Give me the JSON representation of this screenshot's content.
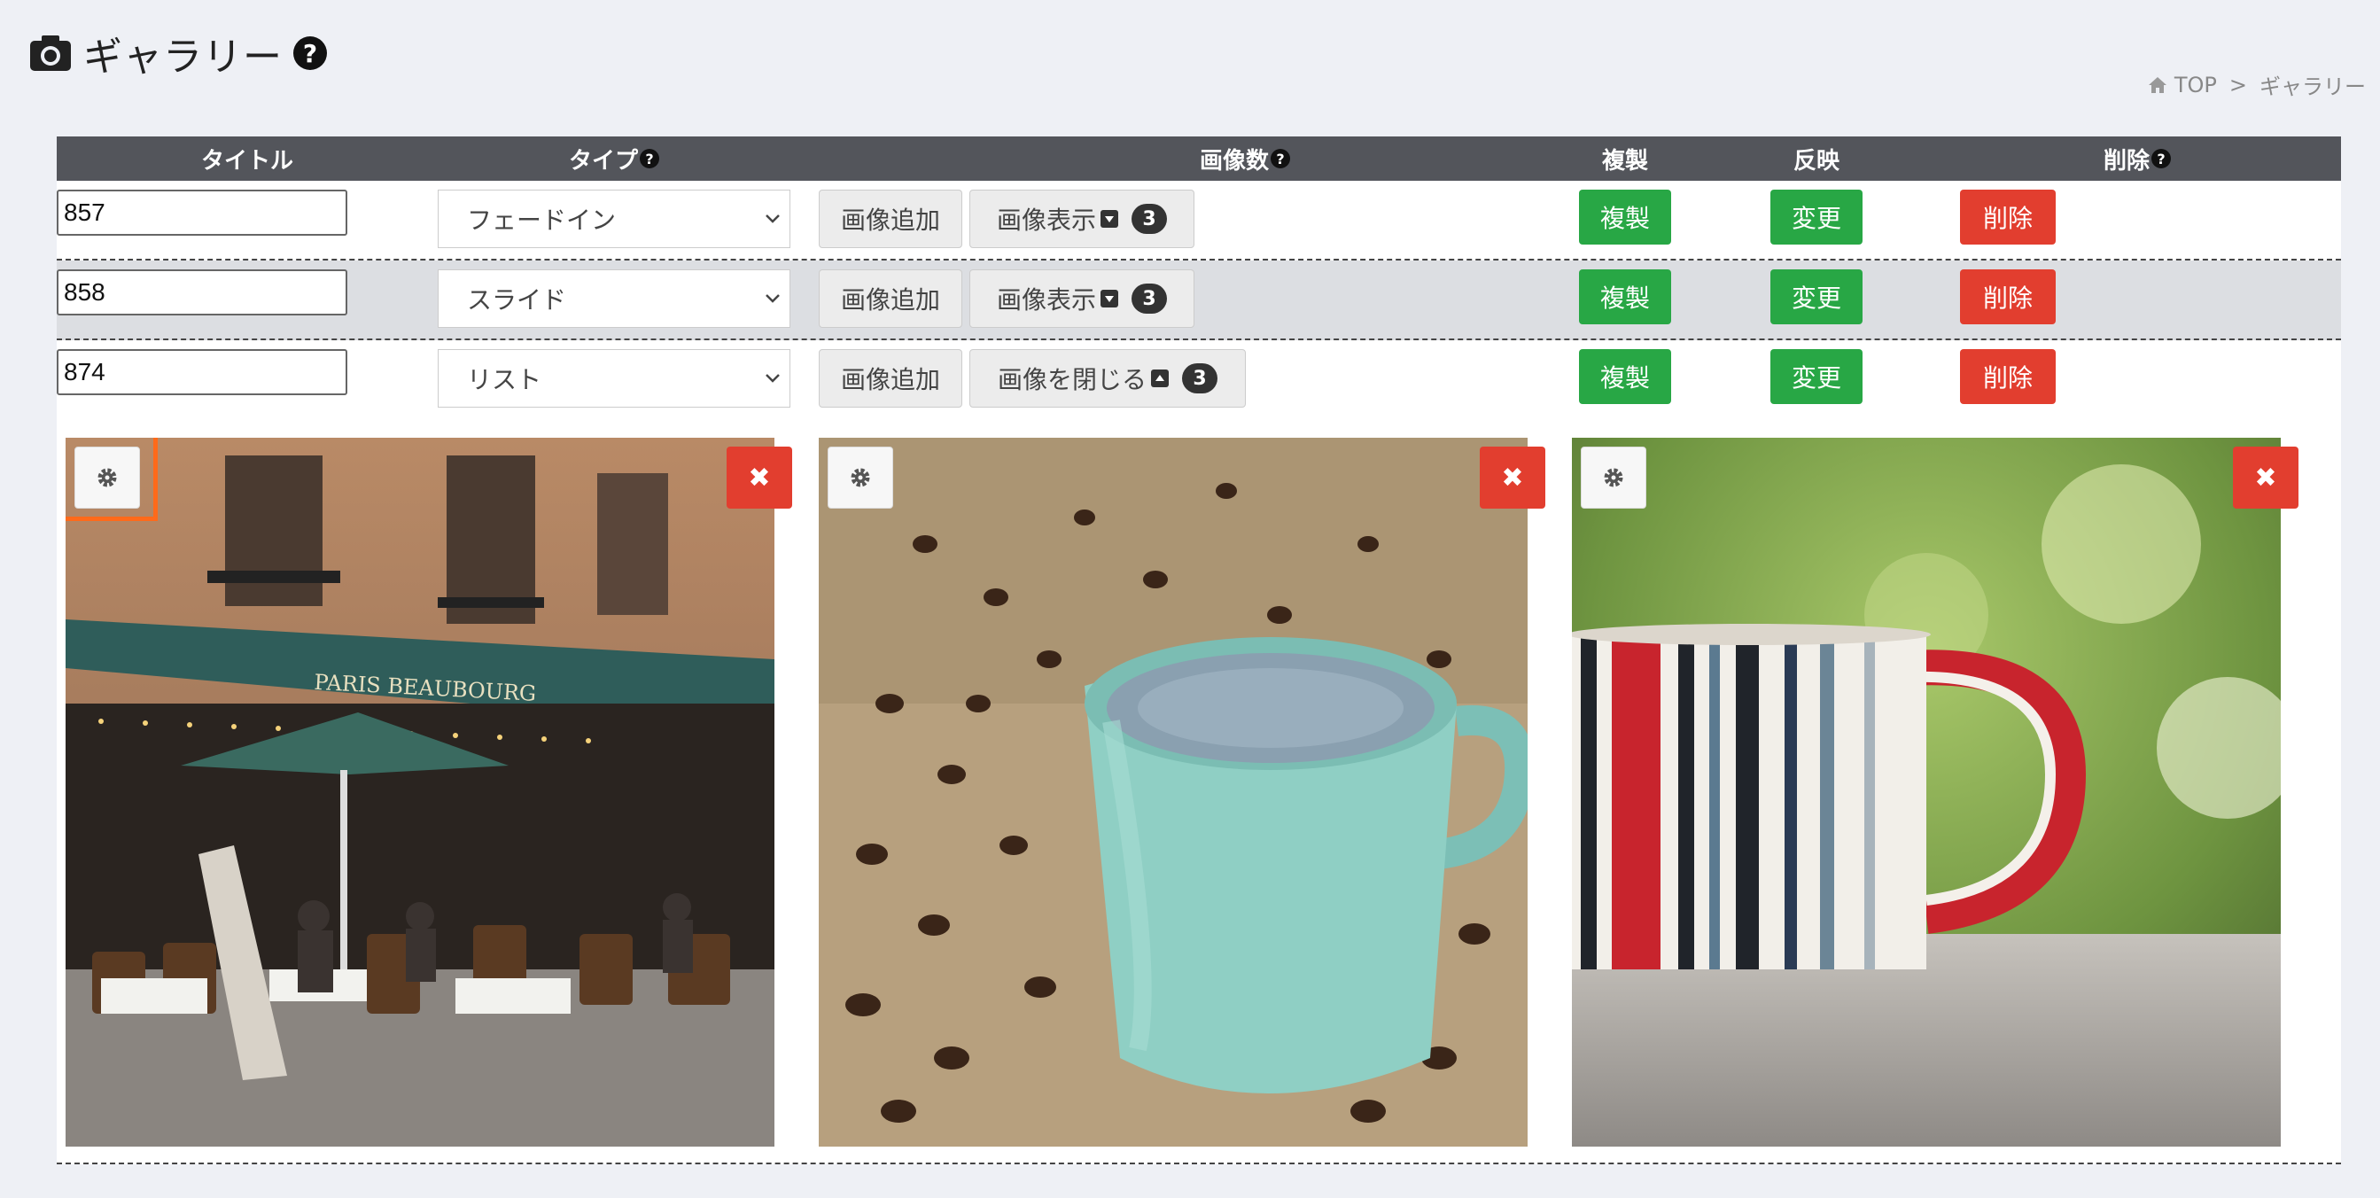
{
  "page": {
    "title": "ギャラリー",
    "help": "?",
    "breadcrumb": {
      "home": "TOP",
      "separator": ">",
      "current": "ギャラリー"
    }
  },
  "table": {
    "headers": {
      "title": "タイトル",
      "type": "タイプ",
      "image_count": "画像数",
      "copy": "複製",
      "apply": "反映",
      "delete": "削除"
    },
    "rows": [
      {
        "title_value": "857",
        "type": "フェードイン",
        "add_label": "画像追加",
        "view_label": "画像表示",
        "count": "3",
        "copy_label": "複製",
        "apply_label": "変更",
        "delete_label": "削除"
      },
      {
        "title_value": "858",
        "type": "スライド",
        "add_label": "画像追加",
        "view_label": "画像表示",
        "count": "3",
        "copy_label": "複製",
        "apply_label": "変更",
        "delete_label": "削除"
      },
      {
        "title_value": "874",
        "type": "リスト",
        "add_label": "画像追加",
        "view_label": "画像を閉じる",
        "count": "3",
        "copy_label": "複製",
        "apply_label": "変更",
        "delete_label": "削除"
      }
    ]
  },
  "gallery": {
    "images": [
      {
        "name": "paris-cafe-photo",
        "sign": "PARIS BEAUBOURG"
      },
      {
        "name": "coffee-beans-cup-photo"
      },
      {
        "name": "striped-mug-photo"
      }
    ],
    "delete_symbol": "✖"
  },
  "colors": {
    "header_bg": "#53555b",
    "green": "#28a745",
    "red": "#e23e2f",
    "highlight": "#ff6a1a"
  }
}
